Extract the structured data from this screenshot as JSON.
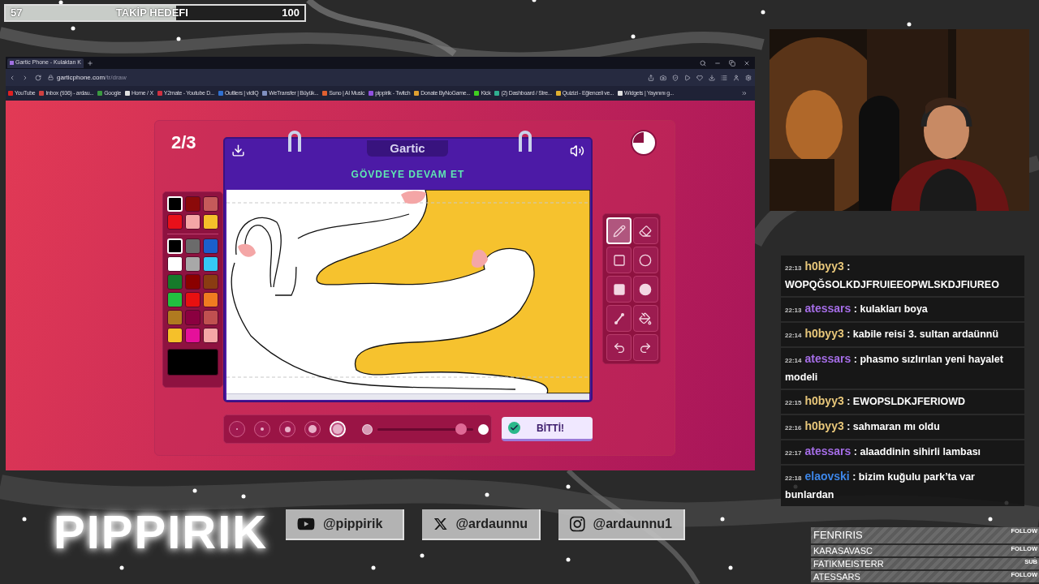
{
  "goal_bar": {
    "current": "57",
    "title": "TAKİP HEDEFI",
    "target": "100",
    "level": 0.57
  },
  "browser": {
    "tab_title": "Gartic Phone - Kulaktan K",
    "url_host": "garticphone.com",
    "url_path": "/tr/draw",
    "bookmarks": [
      {
        "title": "YouTube",
        "color": "#e02020"
      },
      {
        "title": "Inbox (936) - ardau...",
        "color": "#d04040"
      },
      {
        "title": "Google",
        "color": "#3a9a40"
      },
      {
        "title": "Home / X",
        "color": "#e0e0e0"
      },
      {
        "title": "Y2mate - Youtube D...",
        "color": "#d03040"
      },
      {
        "title": "Outliers | vidIQ",
        "color": "#3070d0"
      },
      {
        "title": "WeTransfer | Büyük...",
        "color": "#8090c0"
      },
      {
        "title": "Suno | AI Music",
        "color": "#e06030"
      },
      {
        "title": "pippirik - Twitch",
        "color": "#9050e0"
      },
      {
        "title": "Donate ByNoGame...",
        "color": "#e0a030"
      },
      {
        "title": "Kick",
        "color": "#40d020"
      },
      {
        "title": "(2) Dashboard / Stre...",
        "color": "#30b090"
      },
      {
        "title": "Quizizi - Eğlenceli ve...",
        "color": "#e0b030"
      },
      {
        "title": "Widgets | Yayınını g...",
        "color": "#e0e0e0"
      }
    ]
  },
  "game": {
    "round": "2/3",
    "logo": "Gartic",
    "prompt": "GÖVDEYE DEVAM ET",
    "recent_colors": [
      {
        "color": "#000000",
        "selected": true
      },
      {
        "color": "#8b0a0a",
        "selected": false
      },
      {
        "color": "#c55a5a",
        "selected": false
      },
      {
        "color": "#e8101a",
        "selected": false
      },
      {
        "color": "#f4a6a6",
        "selected": false
      },
      {
        "color": "#f5c02a",
        "selected": false
      }
    ],
    "colors": [
      {
        "color": "#000000",
        "selected": true
      },
      {
        "color": "#6b6b6b",
        "selected": false
      },
      {
        "color": "#1a5fcc",
        "selected": false
      },
      {
        "color": "#ffffff",
        "selected": false
      },
      {
        "color": "#a8a8a8",
        "selected": false
      },
      {
        "color": "#35c8f5",
        "selected": false
      },
      {
        "color": "#167a2a",
        "selected": false
      },
      {
        "color": "#8b0000",
        "selected": false
      },
      {
        "color": "#8a3c12",
        "selected": false
      },
      {
        "color": "#22c040",
        "selected": false
      },
      {
        "color": "#e81010",
        "selected": false
      },
      {
        "color": "#f07b20",
        "selected": false
      },
      {
        "color": "#b07a20",
        "selected": false
      },
      {
        "color": "#8b0040",
        "selected": false
      },
      {
        "color": "#c05050",
        "selected": false
      },
      {
        "color": "#f5c02a",
        "selected": false
      },
      {
        "color": "#e5109a",
        "selected": false
      },
      {
        "color": "#f4a6a6",
        "selected": false
      }
    ],
    "current_color": {
      "color": "#000000"
    },
    "tools": [
      {
        "kind": "pencil",
        "selected": true
      },
      {
        "kind": "eraser",
        "selected": false
      },
      {
        "kind": "rectangle",
        "selected": false
      },
      {
        "kind": "ellipse",
        "selected": false
      },
      {
        "kind": "filled_rectangle",
        "selected": false
      },
      {
        "kind": "filled_ellipse",
        "selected": false
      },
      {
        "kind": "line",
        "selected": false
      },
      {
        "kind": "bucket",
        "selected": false
      },
      {
        "kind": "undo",
        "selected": false
      },
      {
        "kind": "redo",
        "selected": false
      }
    ],
    "brush_sizes": [
      {
        "selected": false
      },
      {
        "selected": false
      },
      {
        "selected": false
      },
      {
        "selected": false
      },
      {
        "selected": true
      }
    ],
    "opacity": {
      "level": 0.87
    },
    "done_button": "BİTTİ!"
  },
  "chat": [
    {
      "time": "22:13",
      "user": "h0byy3",
      "color": "#e8c77a",
      "separator": ":",
      "text": "WOPQĞSOLKDJFRUIEEOPWLSKDJFIUREO"
    },
    {
      "time": "22:13",
      "user": "atessars",
      "color": "#a66ee8",
      "separator": ":",
      "text": "kulakları boya"
    },
    {
      "time": "22:14",
      "user": "h0byy3",
      "color": "#e8c77a",
      "separator": ":",
      "text": "kabile reisi 3. sultan ardaünnü"
    },
    {
      "time": "22:14",
      "user": "atessars",
      "color": "#a66ee8",
      "separator": ":",
      "text": "phasmo sızlırılan yeni hayalet modeli"
    },
    {
      "time": "22:15",
      "user": "h0byy3",
      "color": "#e8c77a",
      "separator": ":",
      "text": "EWOPSLDKJFERIOWD"
    },
    {
      "time": "22:16",
      "user": "h0byy3",
      "color": "#e8c77a",
      "separator": ":",
      "text": "sahmaran mı oldu"
    },
    {
      "time": "22:17",
      "user": "atessars",
      "color": "#a66ee8",
      "separator": ":",
      "text": "alaaddinin sihirli lambası"
    },
    {
      "time": "22:18",
      "user": "elaovski",
      "color": "#3d86e8",
      "separator": ":",
      "text": "bizim kuğulu park’ta var bunlardan"
    }
  ],
  "channel_logo": "PIPPIRIK",
  "socials": [
    {
      "kind": "youtube",
      "handle": "@pippirik"
    },
    {
      "kind": "x",
      "handle": "@ardaunnu"
    },
    {
      "kind": "instagram",
      "handle": "@ardaunnu1"
    }
  ],
  "events": [
    {
      "name": "FENRIRIS",
      "type": "FOLLOW"
    },
    {
      "name": "KARASAVASC",
      "type": "FOLLOW"
    },
    {
      "name": "FATIKMEISTERR",
      "type": "SUB"
    },
    {
      "name": "ATESSARS",
      "type": "FOLLOW"
    }
  ]
}
